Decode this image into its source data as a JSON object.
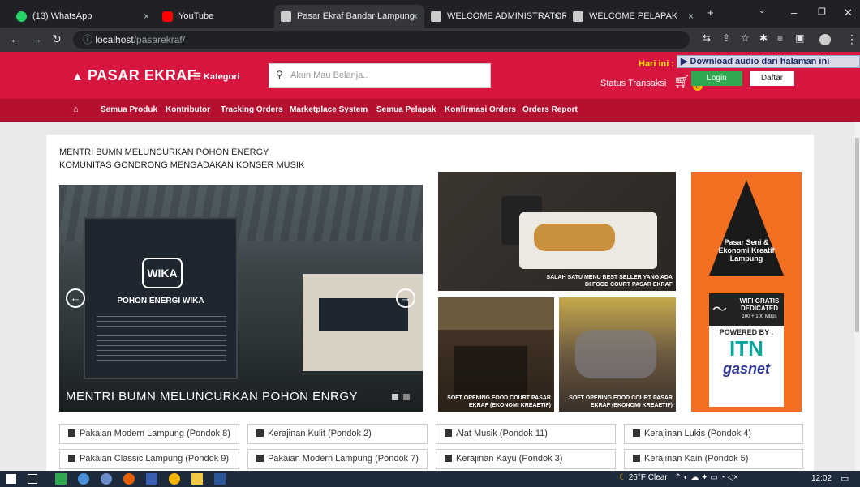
{
  "browser": {
    "tabs": [
      {
        "label": "(13) WhatsApp",
        "icon": "whatsapp-icon",
        "color": "#25d366"
      },
      {
        "label": "YouTube",
        "icon": "youtube-icon",
        "color": "#ff0000"
      },
      {
        "label": "Pasar Ekraf Bandar Lampung",
        "icon": "site-icon",
        "color": "#cccccc",
        "active": true
      },
      {
        "label": "WELCOME ADMINISTRATOR",
        "icon": "site-icon",
        "color": "#cccccc"
      },
      {
        "label": "WELCOME PELAPAK",
        "icon": "site-icon",
        "color": "#cccccc"
      }
    ],
    "url_host": "localhost",
    "url_path": "/pasarekraf/",
    "extension_banner": "Download audio dari halaman ini"
  },
  "header": {
    "logo": "PASAR EKRAF",
    "kategori": "Kategori",
    "search_placeholder": "Akun Mau Belanja..",
    "hari_ini": "Hari ini :",
    "status_transaksi": "Status Transaksi",
    "cart_count": "0",
    "login": "Login",
    "daftar": "Daftar",
    "accent": "#d6163e"
  },
  "menu": [
    "Semua Produk",
    "Kontributor",
    "Tracking Orders",
    "Marketplace System",
    "Semua Pelapak",
    "Konfirmasi Orders",
    "Orders Report"
  ],
  "news": [
    "MENTRI BUMN MELUNCURKAN POHON ENERGY",
    "KOMUNITAS GONDRONG MENGADAKAN KONSER MUSIK"
  ],
  "slider": {
    "caption": "MENTRI BUMN MELUNCURKAN POHON ENRGY",
    "sign_title": "POHON ENERGI WIKA",
    "sign_logo": "WIKA"
  },
  "promos": {
    "food": "SALAH SATU MENU BEST SELLER YANG ADA DI FOOD COURT PASAR EKRAF",
    "opening1": "SOFT OPENING FOOD COURT PASAR EKRAF (EKONOMI KREAETIF)",
    "opening2": "SOFT OPENING FOOD COURT PASAR EKRAF (EKONOMI KREAETIF)",
    "banner_title": "Pasar Seni & Ekonomi Kreatif Lampung",
    "wifi": "WIFI GRATIS DEDICATED",
    "wifi_speed": "100 + 100 Mbps",
    "powered": "POWERED BY :",
    "itn": "ITN",
    "gasnet": "gasnet"
  },
  "categories": [
    "Pakaian Modern Lampung (Pondok 8)",
    "Kerajinan Kulit (Pondok 2)",
    "Alat Musik (Pondok 11)",
    "Kerajinan Lukis (Pondok 4)",
    "Pakaian Classic Lampung (Pondok 9)",
    "Pakaian Modern Lampung (Pondok 7)",
    "Kerajinan Kayu (Pondok 3)",
    "Kerajinan Kain (Pondok 5)"
  ],
  "taskbar": {
    "weather": "26°F  Clear",
    "time": "12:02"
  }
}
